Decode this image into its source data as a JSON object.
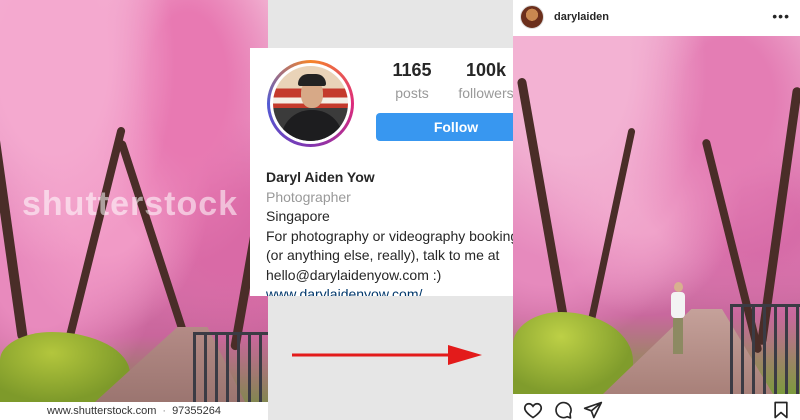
{
  "stock": {
    "watermark": "shutterstock",
    "footer_site": "www.shutterstock.com",
    "footer_sep": "·",
    "footer_id": "97355264"
  },
  "profile": {
    "posts_count": "1165",
    "posts_label": "posts",
    "followers_count": "100k",
    "followers_label": "followers",
    "follow_label": "Follow",
    "name": "Daryl Aiden Yow",
    "role": "Photographer",
    "location": "Singapore",
    "bio_line1": "For photography or videography bookings",
    "bio_line2": "(or anything else, really), talk to me at",
    "bio_line3": "hello@darylaidenyow.com :)",
    "website": "www.darylaidenyow.com/"
  },
  "post": {
    "username": "darylaiden",
    "more_icon": "more-dots-icon"
  },
  "icons": {
    "like": "heart-icon",
    "comment": "comment-icon",
    "share": "send-icon",
    "save": "bookmark-icon",
    "arrow": "red-arrow"
  },
  "colors": {
    "follow_button": "#3897f0",
    "arrow": "#e31b1b"
  }
}
